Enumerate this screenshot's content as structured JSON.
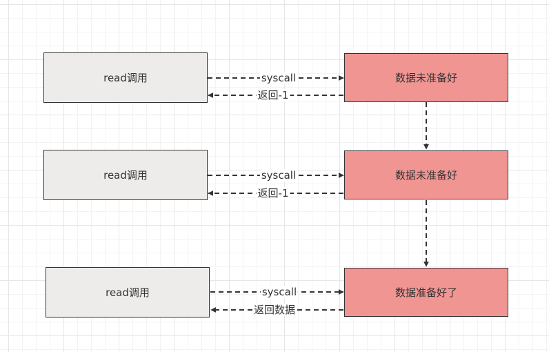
{
  "colors": {
    "client_fill": "#eeeceb",
    "kernel_fill": "#f19593",
    "stroke": "#333333"
  },
  "rows": [
    {
      "client": "read调用",
      "kernel": "数据未准备好",
      "request": "syscall",
      "response": "返回-1"
    },
    {
      "client": "read调用",
      "kernel": "数据未准备好",
      "request": "syscall",
      "response": "返回-1"
    },
    {
      "client": "read调用",
      "kernel": "数据准备好了",
      "request": "syscall",
      "response": "返回数据"
    }
  ]
}
